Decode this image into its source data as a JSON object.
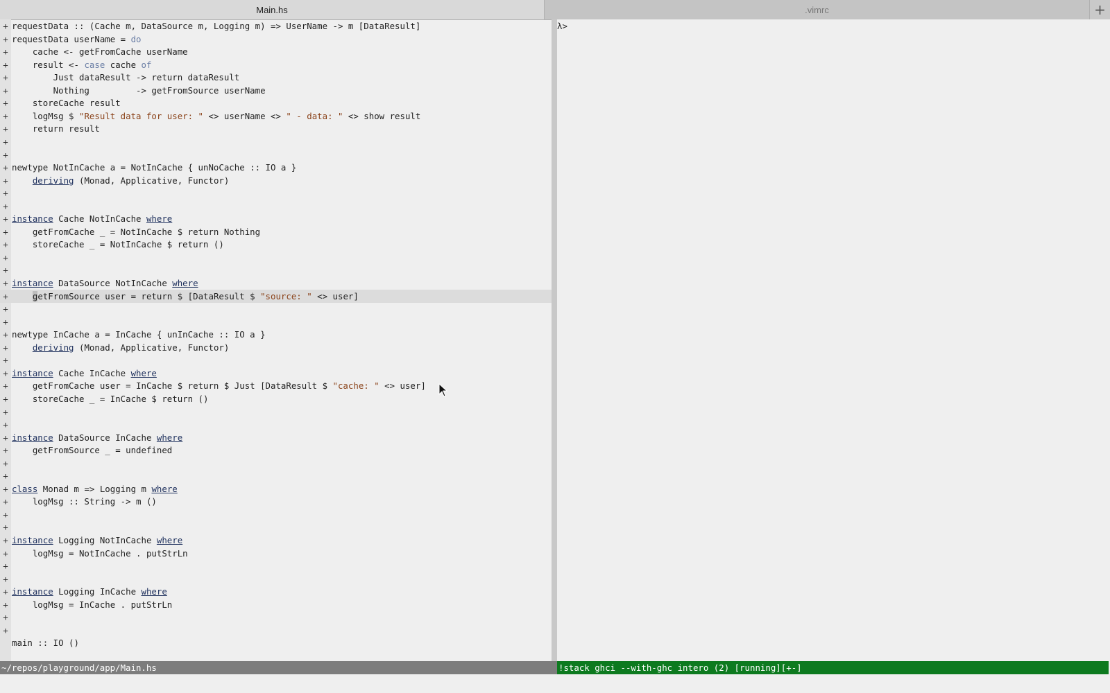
{
  "tabs": [
    {
      "label": "Main.hs",
      "active": true
    },
    {
      "label": ".vimrc",
      "active": false
    }
  ],
  "new_tab_label": "+",
  "editor": {
    "sign": "+",
    "lines": [
      [
        [
          "requestData :: (Cache m, DataSource m, Logging m) => UserName -> m [DataResult]",
          ""
        ]
      ],
      [
        [
          "requestData userName = ",
          ""
        ],
        [
          "do",
          "kw2"
        ]
      ],
      [
        [
          "    cache <- getFromCache userName",
          ""
        ]
      ],
      [
        [
          "    result <- ",
          ""
        ],
        [
          "case",
          "kw2"
        ],
        [
          " cache ",
          ""
        ],
        [
          "of",
          "kw2"
        ]
      ],
      [
        [
          "        Just dataResult -> return dataResult",
          ""
        ]
      ],
      [
        [
          "        Nothing         -> getFromSource userName",
          ""
        ]
      ],
      [
        [
          "    storeCache result",
          ""
        ]
      ],
      [
        [
          "    logMsg $ ",
          ""
        ],
        [
          "\"Result data for user: \"",
          "str"
        ],
        [
          " <> userName <> ",
          ""
        ],
        [
          "\" - data: \"",
          "str"
        ],
        [
          " <> show result",
          ""
        ]
      ],
      [
        [
          "    return result",
          ""
        ]
      ],
      [],
      [],
      [
        [
          "newtype NotInCache a = NotInCache { unNoCache :: IO a }",
          ""
        ]
      ],
      [
        [
          "    ",
          ""
        ],
        [
          "deriving",
          "kw"
        ],
        [
          " (Monad, Applicative, Functor)",
          ""
        ]
      ],
      [],
      [],
      [
        [
          "instance",
          "kw"
        ],
        [
          " Cache NotInCache ",
          ""
        ],
        [
          "where",
          "kw"
        ]
      ],
      [
        [
          "    getFromCache _ = NotInCache $ return Nothing",
          ""
        ]
      ],
      [
        [
          "    storeCache _ = NotInCache $ return ()",
          ""
        ]
      ],
      [],
      [],
      [
        [
          "instance",
          "kw"
        ],
        [
          " DataSource NotInCache ",
          ""
        ],
        [
          "where",
          "kw"
        ]
      ],
      [
        [
          "    ",
          ""
        ],
        [
          "g",
          "cursor"
        ],
        [
          "etFromSource user = return $ [DataResult $ ",
          ""
        ],
        [
          "\"source: \"",
          "str"
        ],
        [
          " <> user]",
          ""
        ]
      ],
      [],
      [],
      [
        [
          "newtype InCache a = InCache { unInCache :: IO a }",
          ""
        ]
      ],
      [
        [
          "    ",
          ""
        ],
        [
          "deriving",
          "kw"
        ],
        [
          " (Monad, Applicative, Functor)",
          ""
        ]
      ],
      [],
      [
        [
          "instance",
          "kw"
        ],
        [
          " Cache InCache ",
          ""
        ],
        [
          "where",
          "kw"
        ]
      ],
      [
        [
          "    getFromCache user = InCache $ return $ Just [DataResult $ ",
          ""
        ],
        [
          "\"cache: \"",
          "str"
        ],
        [
          " <> user]",
          ""
        ]
      ],
      [
        [
          "    storeCache _ = InCache $ return ()",
          ""
        ]
      ],
      [],
      [],
      [
        [
          "instance",
          "kw"
        ],
        [
          " DataSource InCache ",
          ""
        ],
        [
          "where",
          "kw"
        ]
      ],
      [
        [
          "    getFromSource _ = undefined",
          ""
        ]
      ],
      [],
      [],
      [
        [
          "class",
          "kw"
        ],
        [
          " Monad m => Logging m ",
          ""
        ],
        [
          "where",
          "kw"
        ]
      ],
      [
        [
          "    logMsg :: String -> m ()",
          ""
        ]
      ],
      [],
      [],
      [
        [
          "instance",
          "kw"
        ],
        [
          " Logging NotInCache ",
          ""
        ],
        [
          "where",
          "kw"
        ]
      ],
      [
        [
          "    logMsg = NotInCache . putStrLn",
          ""
        ]
      ],
      [],
      [],
      [
        [
          "instance",
          "kw"
        ],
        [
          " Logging InCache ",
          ""
        ],
        [
          "where",
          "kw"
        ]
      ],
      [
        [
          "    logMsg = InCache . putStrLn",
          ""
        ]
      ],
      [],
      [],
      [
        [
          "main :: IO ()",
          ""
        ]
      ]
    ],
    "no_sign_lines": [
      48
    ],
    "cursorline": 21
  },
  "terminal": {
    "prompt": "λ>"
  },
  "statusline": {
    "left": "~/repos/playground/app/Main.hs",
    "right": "!stack ghci --with-ghc intero (2) [running][+-]"
  },
  "colors": {
    "status_left_bg": "#7d7d7d",
    "status_right_bg": "#0d7a1f",
    "keyword": "#1d2f5c",
    "string": "#8a4219"
  }
}
